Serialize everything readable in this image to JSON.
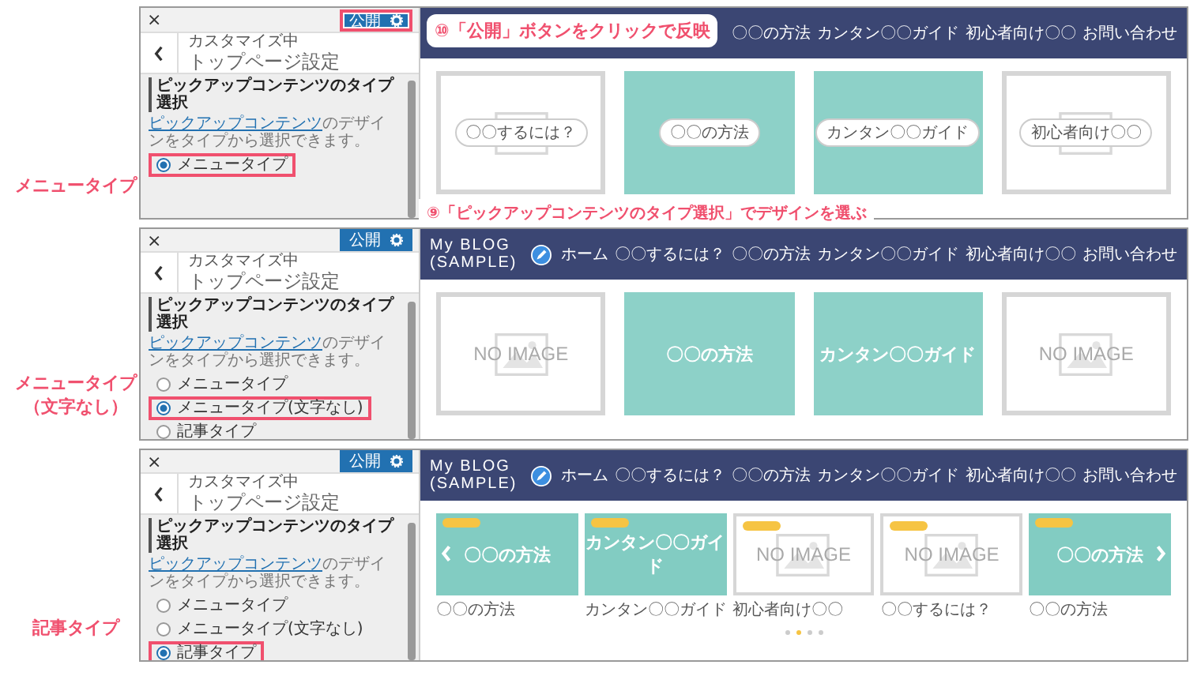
{
  "panels": [
    {
      "label": "メニュータイプ",
      "callouts": [
        {
          "kind": "top",
          "text": "⑩「公開」ボタンをクリックで反映"
        },
        {
          "kind": "bottom",
          "text": "⑨「ピックアップコンテンツのタイプ選択」でデザインを選ぶ"
        }
      ],
      "sidebar": {
        "close": "×",
        "publish": {
          "label": "公開",
          "highlighted": true
        },
        "subtitle": "カスタマイズ中",
        "title": "トップページ設定",
        "heading": "ピックアップコンテンツのタイプ選択",
        "description_link": "ピックアップコンテンツ",
        "description": "のデザインをタイプから選択できます。",
        "options": [
          {
            "label": "メニュータイプ",
            "selected": true,
            "highlighted": true
          }
        ]
      },
      "preview": {
        "nav": [
          "〇〇の方法",
          "カンタン〇〇ガイド",
          "初心者向け〇〇",
          "お問い合わせ"
        ],
        "cards": [
          {
            "kind": "no-image",
            "pill": "〇〇するには？"
          },
          {
            "kind": "color",
            "pill": "〇〇の方法"
          },
          {
            "kind": "color",
            "pill": "カンタン〇〇ガイド"
          },
          {
            "kind": "no-image",
            "pill": "初心者向け〇〇"
          }
        ]
      }
    },
    {
      "label": "メニュータイプ",
      "sublabel": "（文字なし）",
      "sidebar": {
        "close": "×",
        "publish": {
          "label": "公開",
          "highlighted": false
        },
        "subtitle": "カスタマイズ中",
        "title": "トップページ設定",
        "heading": "ピックアップコンテンツのタイプ選択",
        "description_link": "ピックアップコンテンツ",
        "description": "のデザインをタイプから選択できます。",
        "options": [
          {
            "label": "メニュータイプ",
            "selected": false,
            "highlighted": false
          },
          {
            "label": "メニュータイプ(文字なし)",
            "selected": true,
            "highlighted": true
          },
          {
            "label": "記事タイプ",
            "selected": false,
            "highlighted": false
          }
        ]
      },
      "preview": {
        "logo": [
          "My BLOG",
          "(SAMPLE)"
        ],
        "nav": [
          "ホーム",
          "〇〇するには？",
          "〇〇の方法",
          "カンタン〇〇ガイド",
          "初心者向け〇〇",
          "お問い合わせ"
        ],
        "cards": [
          {
            "kind": "no-image",
            "text": "NO IMAGE"
          },
          {
            "kind": "color",
            "text": "〇〇の方法"
          },
          {
            "kind": "color",
            "text": "カンタン〇〇ガイド"
          },
          {
            "kind": "no-image",
            "text": "NO IMAGE"
          }
        ]
      }
    },
    {
      "label": "記事タイプ",
      "sidebar": {
        "close": "×",
        "publish": {
          "label": "公開",
          "highlighted": false
        },
        "subtitle": "カスタマイズ中",
        "title": "トップページ設定",
        "heading": "ピックアップコンテンツのタイプ選択",
        "description_link": "ピックアップコンテンツ",
        "description": "のデザインをタイプから選択できます。",
        "options": [
          {
            "label": "メニュータイプ",
            "selected": false,
            "highlighted": false
          },
          {
            "label": "メニュータイプ(文字なし)",
            "selected": false,
            "highlighted": false
          },
          {
            "label": "記事タイプ",
            "selected": true,
            "highlighted": true
          }
        ]
      },
      "preview": {
        "logo": [
          "My BLOG",
          "(SAMPLE)"
        ],
        "nav": [
          "ホーム",
          "〇〇するには？",
          "〇〇の方法",
          "カンタン〇〇ガイド",
          "初心者向け〇〇",
          "お問い合わせ"
        ],
        "cards": [
          {
            "kind": "color",
            "text": "〇〇の方法",
            "caption": "〇〇の方法"
          },
          {
            "kind": "color",
            "text": "カンタン〇〇ガイド",
            "caption": "カンタン〇〇ガイド"
          },
          {
            "kind": "no-image",
            "text": "NO IMAGE",
            "caption": "初心者向け〇〇"
          },
          {
            "kind": "no-image",
            "text": "NO IMAGE",
            "caption": "〇〇するには？"
          },
          {
            "kind": "color",
            "text": "〇〇の方法",
            "caption": "〇〇の方法"
          }
        ],
        "dots": [
          {
            "selected": false
          },
          {
            "selected": true
          },
          {
            "selected": false
          },
          {
            "selected": false
          }
        ]
      }
    }
  ]
}
